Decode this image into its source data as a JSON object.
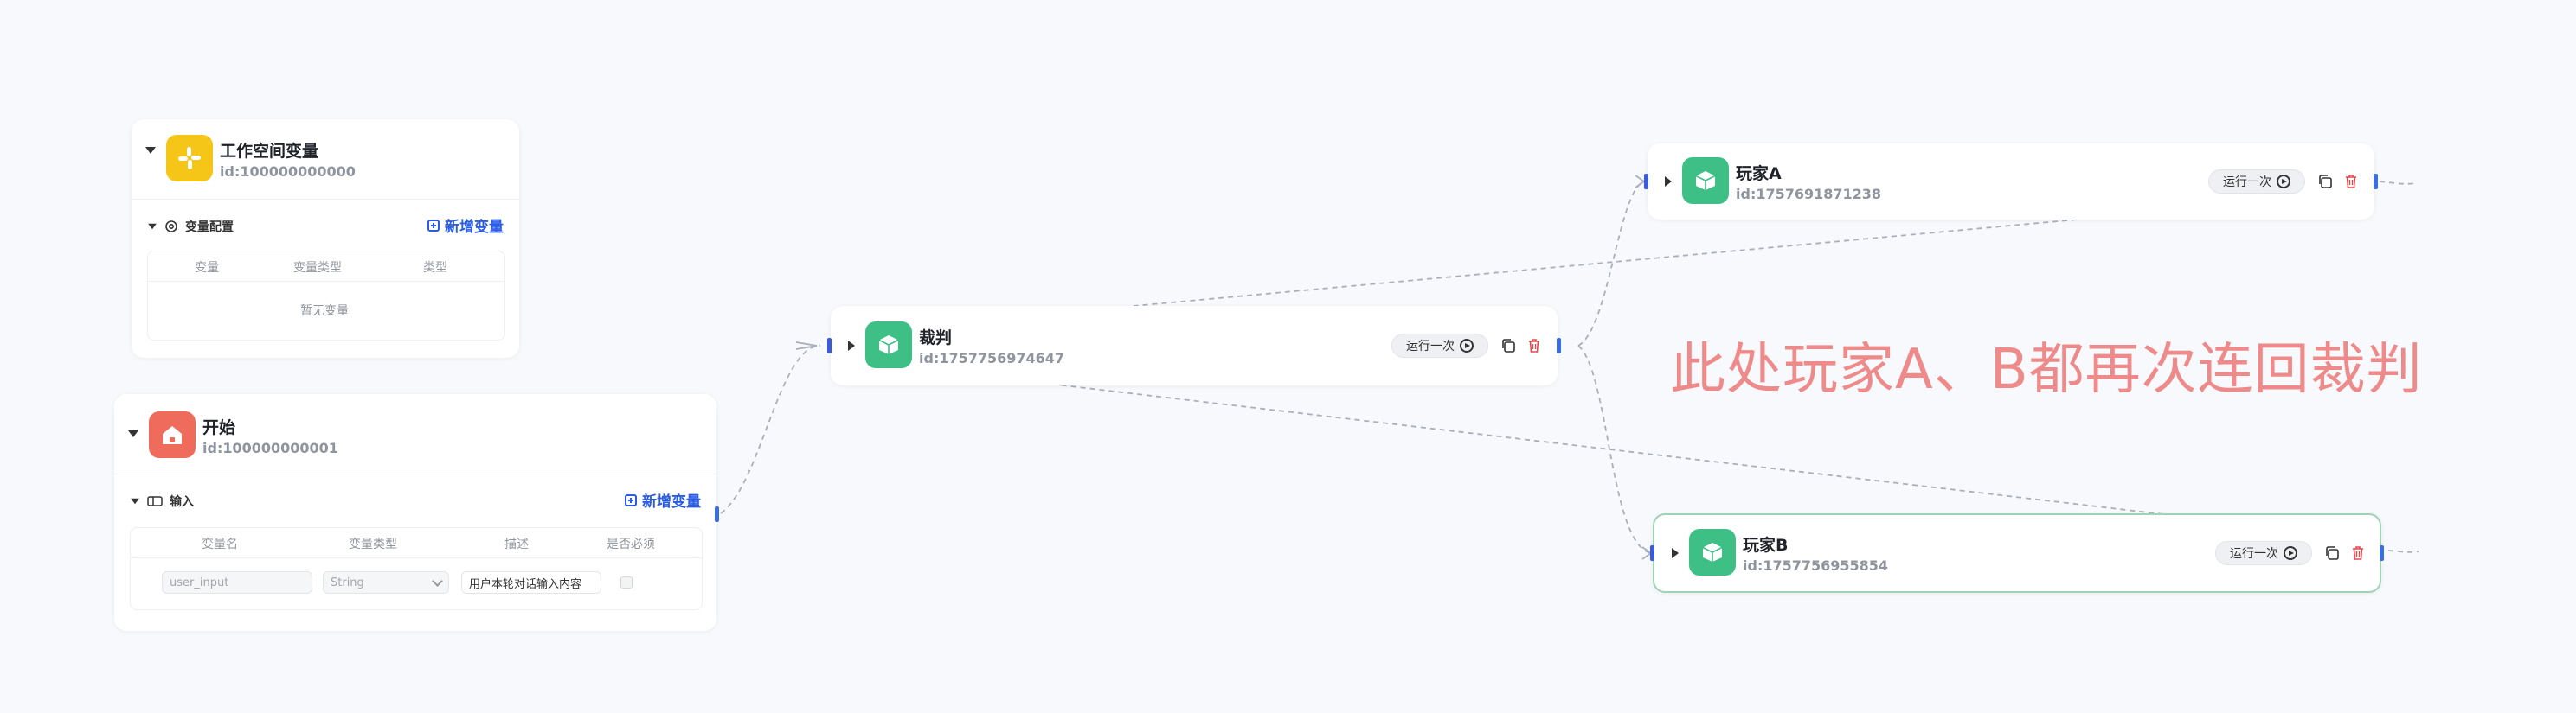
{
  "colors": {
    "accent": "#2b5ce6",
    "handle": "#3b5bdb",
    "annotation": "#ef8a8a",
    "workspace_icon": "#f5c518",
    "start_icon": "#ef6b5b",
    "agent_icon": "#3dbf86",
    "delete": "#e5484d"
  },
  "workspace": {
    "title": "工作空间变量",
    "id": "id:100000000000",
    "icon": "slack-like-logo-icon",
    "section_label": "变量配置",
    "add_label": "新增变量",
    "columns": [
      "变量",
      "变量类型",
      "类型"
    ],
    "empty_text": "暂无变量"
  },
  "start": {
    "title": "开始",
    "id": "id:100000000001",
    "icon": "home-icon",
    "section_label": "输入",
    "add_label": "新增变量",
    "columns": [
      "变量名",
      "变量类型",
      "描述",
      "是否必须"
    ],
    "row": {
      "name": "user_input",
      "type": "String",
      "desc": "用户本轮对话输入内容"
    }
  },
  "judge": {
    "title": "裁判",
    "id": "id:1757756974647",
    "icon": "cube-icon",
    "run_label": "运行一次"
  },
  "player_a": {
    "title": "玩家A",
    "id": "id:1757691871238",
    "icon": "cube-icon",
    "run_label": "运行一次"
  },
  "player_b": {
    "title": "玩家B",
    "id": "id:1757756955854",
    "icon": "cube-icon",
    "run_label": "运行一次"
  },
  "annotation": "此处玩家A、B都再次连回裁判"
}
